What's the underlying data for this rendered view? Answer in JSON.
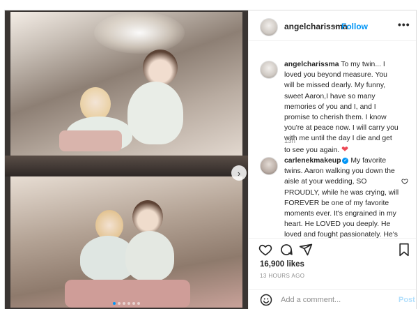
{
  "header": {
    "username": "angelcharissma",
    "separator": "•",
    "follow_label": "Follow",
    "more_label": "•••"
  },
  "caption": {
    "username": "angelcharissma",
    "text": "To my twin... I loved you beyond measure. You will be missed dearly. My funny, sweet Aaron,I have so many memories of you and I, and I promise to cherish them. I know you're at peace now. I will carry you with me until the day I die and get to see you again.",
    "emoji": "❤",
    "age": "13h"
  },
  "comments": [
    {
      "username": "carlenekmakeup",
      "verified": true,
      "text": "My favorite twins. Aaron walking you down the aisle at your wedding, SO PROUDLY, while he was crying, will FOREVER be one of my favorite moments ever. It's engrained in my heart. He LOVED you deeply. He loved and fought passionately. He's at Peace now, and will always be"
    }
  ],
  "engagement": {
    "likes": "16,900 likes",
    "timestamp": "13 HOURS AGO"
  },
  "add_comment": {
    "placeholder": "Add a comment...",
    "post_label": "Post"
  },
  "carousel": {
    "slide_count": 6,
    "active_index": 0
  },
  "colors": {
    "accent": "#0095f6",
    "heart": "#ed4956",
    "muted": "#8e8e8e"
  },
  "icons": [
    "heart-icon",
    "comment-icon",
    "share-icon",
    "save-icon",
    "emoji-icon",
    "chevron-right-icon",
    "verified-icon"
  ]
}
